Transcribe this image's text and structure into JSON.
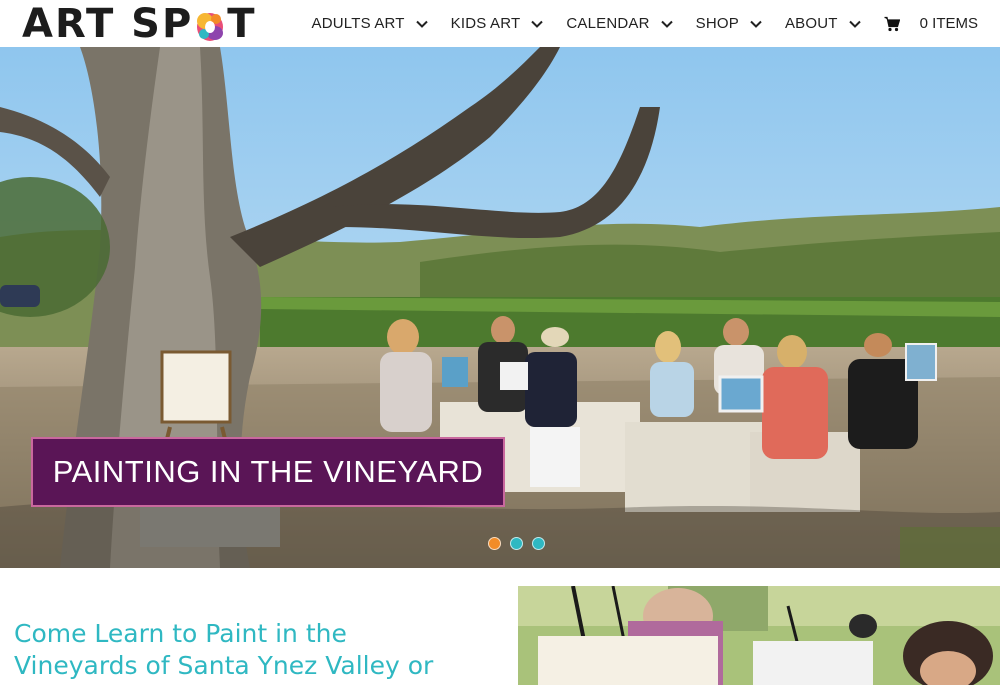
{
  "logo": {
    "text_left": "ART SP",
    "text_right": "T",
    "icon": "paint-splash-o"
  },
  "nav": {
    "items": [
      {
        "label": "ADULTS ART",
        "icon": "chevron-down-icon"
      },
      {
        "label": "KIDS ART",
        "icon": "chevron-down-icon"
      },
      {
        "label": "CALENDAR",
        "icon": "chevron-down-icon"
      },
      {
        "label": "SHOP",
        "icon": "chevron-down-icon"
      },
      {
        "label": "ABOUT",
        "icon": "chevron-down-icon"
      }
    ],
    "cart_icon": "shopping-cart-icon",
    "cart_label": "0 ITEMS"
  },
  "hero": {
    "caption": "PAINTING IN THE VINEYARD",
    "slider_dots": [
      {
        "color": "#f28c28",
        "active": true
      },
      {
        "color": "#2fb8c2",
        "active": false
      },
      {
        "color": "#2fb8c2",
        "active": false
      }
    ]
  },
  "intro": {
    "line1": "Come Learn to Paint in the",
    "line2": "Vineyards of Santa Ynez Valley or"
  },
  "colors": {
    "accent_teal": "#2fb8c2",
    "caption_bg": "#5a1556",
    "caption_border": "#c9689e",
    "dot_orange": "#f28c28"
  }
}
